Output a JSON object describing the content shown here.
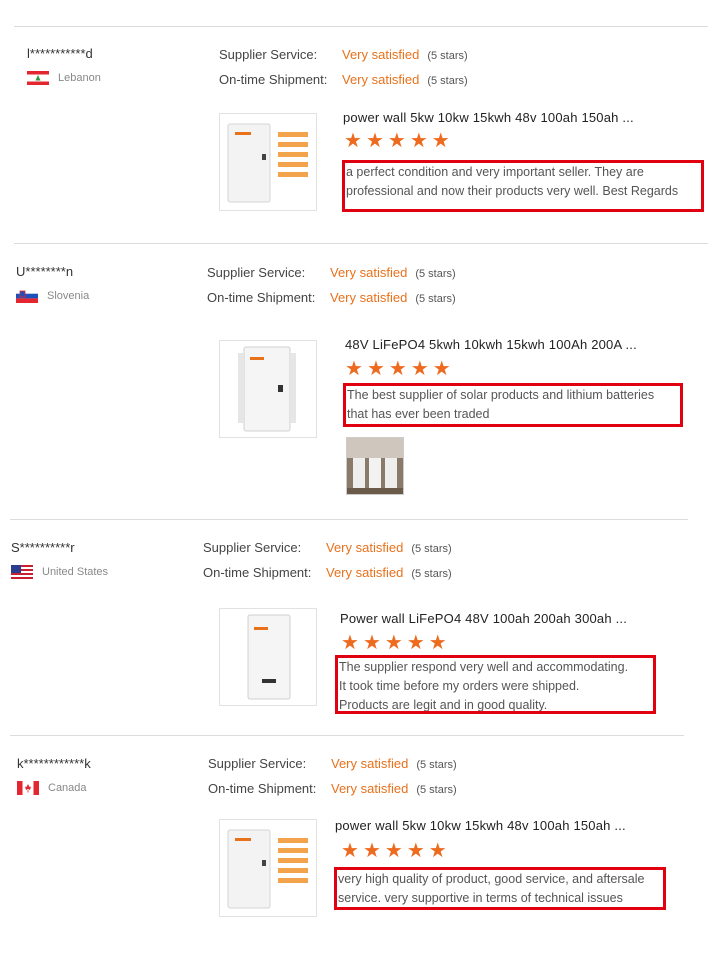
{
  "labels": {
    "supplier_service": "Supplier Service:",
    "ontime_shipment": "On-time Shipment:"
  },
  "colors": {
    "accent": "#e8711c",
    "star": "#ee6a1e",
    "highlight_box": "#e0000f"
  },
  "reviews": [
    {
      "user": "l***********d",
      "country": "Lebanon",
      "flag_icon": "lebanon-flag-icon",
      "supplier_service": "Very satisfied",
      "supplier_stars": "(5 stars)",
      "ontime_shipment": "Very satisfied",
      "ontime_stars": "(5 stars)",
      "product_title": "power wall 5kw 10kw 15kwh 48v 100ah 150ah ...",
      "rating": 5,
      "comment_lines": [
        "a perfect condition and very important seller. They are",
        "professional and now their products very well. Best Regards"
      ]
    },
    {
      "user": "U********n",
      "country": "Slovenia",
      "flag_icon": "slovenia-flag-icon",
      "supplier_service": "Very satisfied",
      "supplier_stars": "(5 stars)",
      "ontime_shipment": "Very satisfied",
      "ontime_stars": "(5 stars)",
      "product_title": "48V LiFePO4 5kwh 10kwh 15kwh 100Ah 200A ...",
      "rating": 5,
      "comment_lines": [
        "The best supplier of solar products and lithium batteries",
        "that has ever been traded"
      ]
    },
    {
      "user": "S**********r",
      "country": "United States",
      "flag_icon": "usa-flag-icon",
      "supplier_service": "Very satisfied",
      "supplier_stars": "(5 stars)",
      "ontime_shipment": "Very satisfied",
      "ontime_stars": "(5 stars)",
      "product_title": "Power wall LiFePO4 48V 100ah 200ah 300ah ...",
      "rating": 5,
      "comment_lines": [
        "The supplier respond very well and accommodating.",
        "It took time before my orders were shipped.",
        "Products are legit and in good quality."
      ]
    },
    {
      "user": "k************k",
      "country": "Canada",
      "flag_icon": "canada-flag-icon",
      "supplier_service": "Very satisfied",
      "supplier_stars": "(5 stars)",
      "ontime_shipment": "Very satisfied",
      "ontime_stars": "(5 stars)",
      "product_title": "power wall 5kw 10kw 15kwh 48v 100ah 150ah ...",
      "rating": 5,
      "comment_lines": [
        "very high quality of product, good service, and aftersale",
        "service. very supportive in terms of technical issues"
      ]
    }
  ]
}
